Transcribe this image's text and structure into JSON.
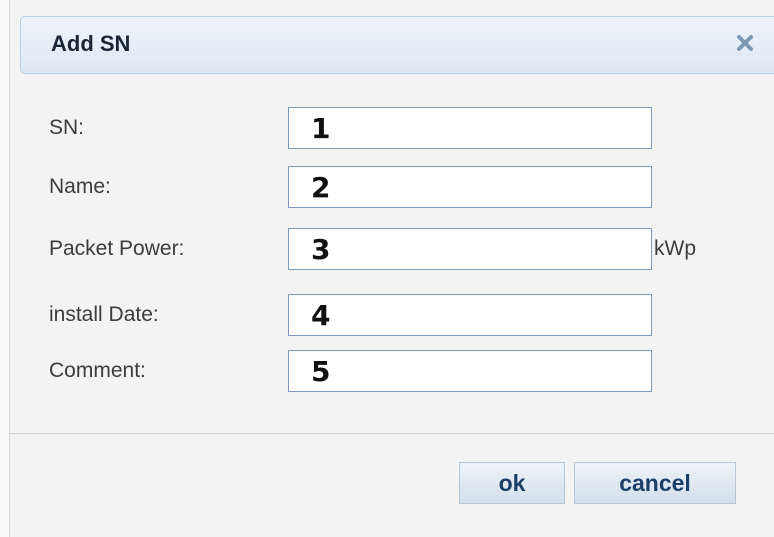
{
  "dialog": {
    "title": "Add SN",
    "close_icon": "close-icon"
  },
  "form": {
    "fields": [
      {
        "label": "SN:",
        "value": "1"
      },
      {
        "label": "Name:",
        "value": "2"
      },
      {
        "label": "Packet Power:",
        "value": "3",
        "unit": "kWp"
      },
      {
        "label": "install Date:",
        "value": "4"
      },
      {
        "label": "Comment:",
        "value": "5"
      }
    ]
  },
  "buttons": {
    "ok_label": "ok",
    "cancel_label": "cancel"
  },
  "colors": {
    "title_bar": "#dde8f4",
    "button_text": "#1b3f66",
    "input_border": "#7a9ab8"
  }
}
